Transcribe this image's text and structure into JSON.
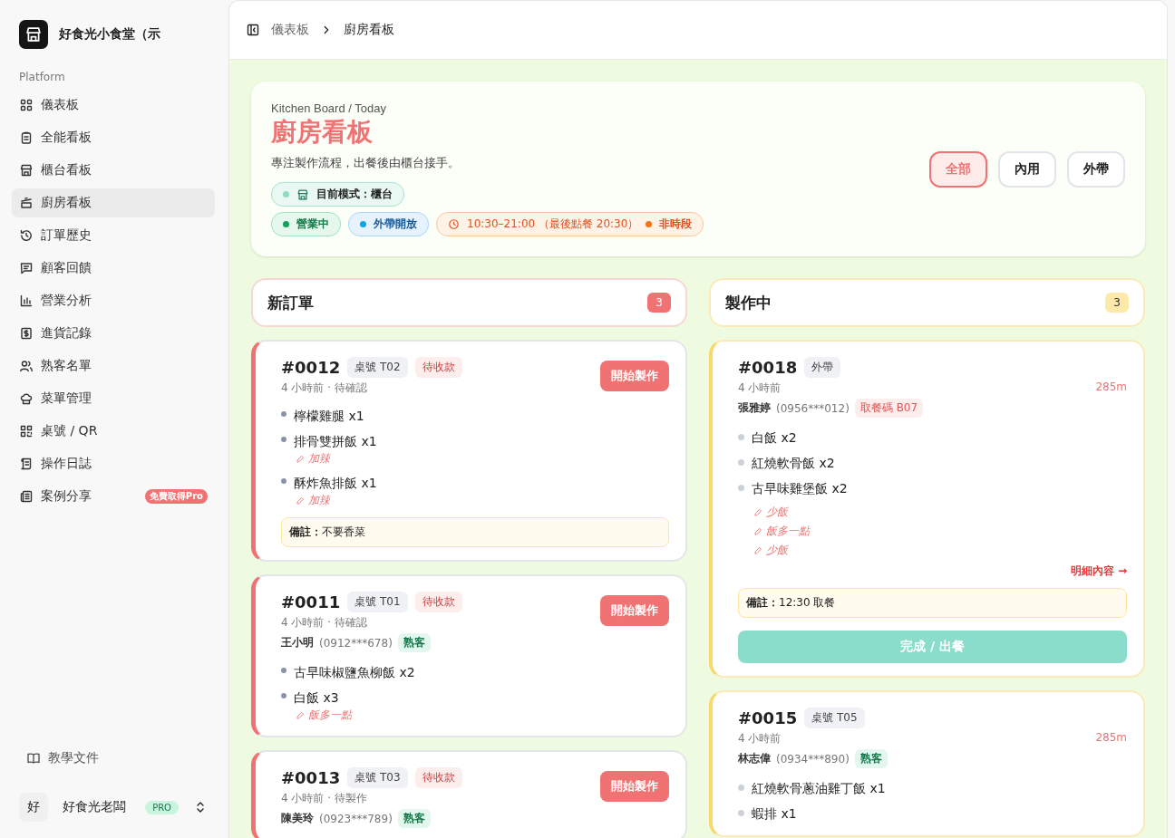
{
  "sidebar": {
    "brand": "好食光小食堂（示",
    "section": "Platform",
    "items": [
      {
        "label": "儀表板",
        "selected": false
      },
      {
        "label": "全能看板",
        "selected": false
      },
      {
        "label": "櫃台看板",
        "selected": false
      },
      {
        "label": "廚房看板",
        "selected": true
      },
      {
        "label": "訂單歷史",
        "selected": false
      },
      {
        "label": "顧客回饋",
        "selected": false
      },
      {
        "label": "營業分析",
        "selected": false
      },
      {
        "label": "進貨記錄",
        "selected": false
      },
      {
        "label": "熟客名單",
        "selected": false
      },
      {
        "label": "菜單管理",
        "selected": false
      },
      {
        "label": "桌號 / QR",
        "selected": false
      },
      {
        "label": "操作日誌",
        "selected": false
      },
      {
        "label": "案例分享",
        "selected": false,
        "badge": "免費取得Pro"
      }
    ],
    "docs": "教學文件",
    "user": {
      "avatar": "好",
      "name": "好食光老闆",
      "plan": "PRO"
    }
  },
  "breadcrumb": [
    "儀表板",
    "廚房看板"
  ],
  "hero": {
    "eyebrow": "Kitchen Board / Today",
    "title": "廚房看板",
    "subtitle": "專注製作流程，出餐後由櫃台接手。",
    "mode": "目前模式：櫃台",
    "pills": [
      {
        "kind": "open",
        "text": "營業中"
      },
      {
        "kind": "takeout",
        "text": "外帶開放"
      },
      {
        "kind": "hours",
        "text": "10:30–21:00 （最後點餐 20:30）",
        "status": "非時段"
      }
    ],
    "filters": [
      {
        "label": "全部",
        "selected": true
      },
      {
        "label": "內用",
        "selected": false
      },
      {
        "label": "外帶",
        "selected": false
      }
    ]
  },
  "columns": [
    {
      "kind": "new",
      "title": "新訂單",
      "count": "3",
      "orders": [
        {
          "number": "#0012",
          "tags": [
            {
              "kind": "table",
              "text": "桌號 T02"
            },
            {
              "kind": "unpaid",
              "text": "待收款"
            }
          ],
          "meta": "4 小時前 · 待確認",
          "action": "開始製作",
          "items": [
            {
              "name": "檸檬雞腿 x1"
            },
            {
              "name": "排骨雙拼飯 x1",
              "notes": [
                "加辣"
              ]
            },
            {
              "name": "酥炸魚排飯 x1",
              "notes": [
                "加辣"
              ]
            }
          ],
          "note": "**備註：**不要香菜"
        },
        {
          "number": "#0011",
          "tags": [
            {
              "kind": "table",
              "text": "桌號 T01"
            },
            {
              "kind": "unpaid",
              "text": "待收款"
            }
          ],
          "meta": "4 小時前 · 待確認",
          "action": "開始製作",
          "customer": {
            "name": "王小明",
            "phone": "(0912***678)",
            "tag": {
              "kind": "regular",
              "text": "熟客"
            }
          },
          "items": [
            {
              "name": "古早味椒鹽魚柳飯 x2"
            },
            {
              "name": "白飯 x3",
              "notes": [
                "飯多一點"
              ]
            }
          ]
        },
        {
          "number": "#0013",
          "tags": [
            {
              "kind": "table",
              "text": "桌號 T03"
            },
            {
              "kind": "unpaid",
              "text": "待收款"
            }
          ],
          "meta": "4 小時前 · 待製作",
          "action": "開始製作",
          "customer": {
            "name": "陳美玲",
            "phone": "(0923***789)",
            "tag": {
              "kind": "regular",
              "text": "熟客"
            }
          }
        }
      ]
    },
    {
      "kind": "cooking",
      "title": "製作中",
      "count": "3",
      "orders": [
        {
          "number": "#0018",
          "tags": [
            {
              "kind": "table",
              "text": "外帶"
            }
          ],
          "meta": "4 小時前",
          "elapsed": "285m",
          "customer": {
            "name": "張雅婷",
            "phone": "(0956***012)",
            "tag": {
              "kind": "pickup",
              "text": "取餐碼 B07"
            }
          },
          "items": [
            {
              "name": "白飯 x2"
            },
            {
              "name": "紅燒軟骨飯 x2"
            },
            {
              "name": "古早味雞堡飯 x2",
              "notes": [
                "少飯",
                "飯多一點",
                "少飯"
              ]
            }
          ],
          "details": "明細內容 →",
          "note": "**備註：**12:30 取餐",
          "action": "完成 / 出餐"
        },
        {
          "number": "#0015",
          "tags": [
            {
              "kind": "table",
              "text": "桌號 T05"
            }
          ],
          "meta": "4 小時前",
          "elapsed": "285m",
          "customer": {
            "name": "林志偉",
            "phone": "(0934***890)",
            "tag": {
              "kind": "regular",
              "text": "熟客"
            }
          },
          "items": [
            {
              "name": "紅燒軟骨蔥油雞丁飯 x1"
            },
            {
              "name": "蝦排 x1"
            }
          ]
        }
      ]
    }
  ]
}
